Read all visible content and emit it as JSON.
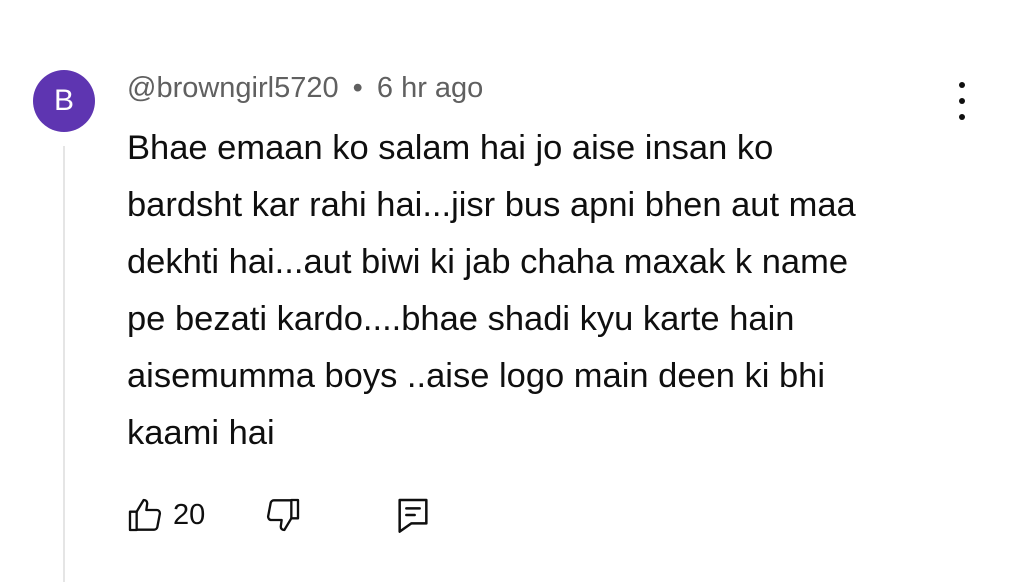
{
  "comment": {
    "avatar_letter": "B",
    "avatar_color": "#5e35b1",
    "author": "@browngirl5720",
    "separator": "•",
    "timestamp": "6 hr ago",
    "text_lines": [
      "Bhae emaan ko salam hai jo aise insan ko",
      "bardsht kar rahi hai...jisr bus apni bhen aut maa",
      "dekhti hai...aut biwi ki jab chaha maxak k name",
      "pe bezati kardo....bhae shadi kyu karte hain",
      "aisemumma boys ..aise logo main deen ki bhi",
      "kaami hai"
    ],
    "like_count": "20",
    "icons": {
      "like": "thumbs-up-icon",
      "dislike": "thumbs-down-icon",
      "reply": "reply-icon",
      "menu": "more-vertical-icon"
    }
  }
}
